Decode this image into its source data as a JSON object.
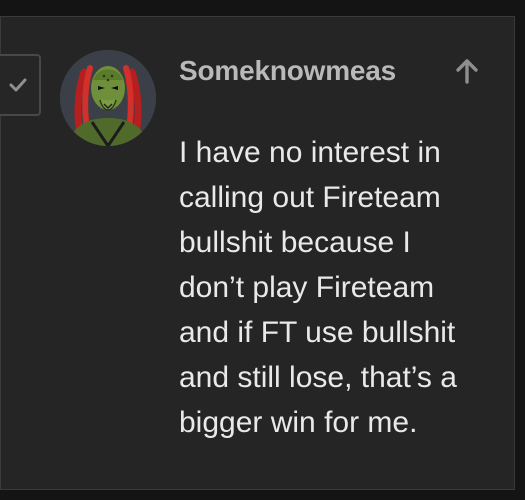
{
  "post": {
    "username": "Someknowmeas",
    "body": "I have no interest in\ncalling out Fireteam\nbullshit because I\ndon’t play Fireteam\nand if FT use bullshit\nand still lose, that’s a\nbigger win for me."
  },
  "icons": {
    "solved": "check-icon",
    "reply": "arrow-up-icon",
    "avatar": "predator-avatar"
  },
  "colors": {
    "page_bg": "#141414",
    "card_bg": "#252525",
    "username": "#b9b9b9",
    "body_text": "#e9e9e9",
    "icon": "#8f8f8f"
  }
}
